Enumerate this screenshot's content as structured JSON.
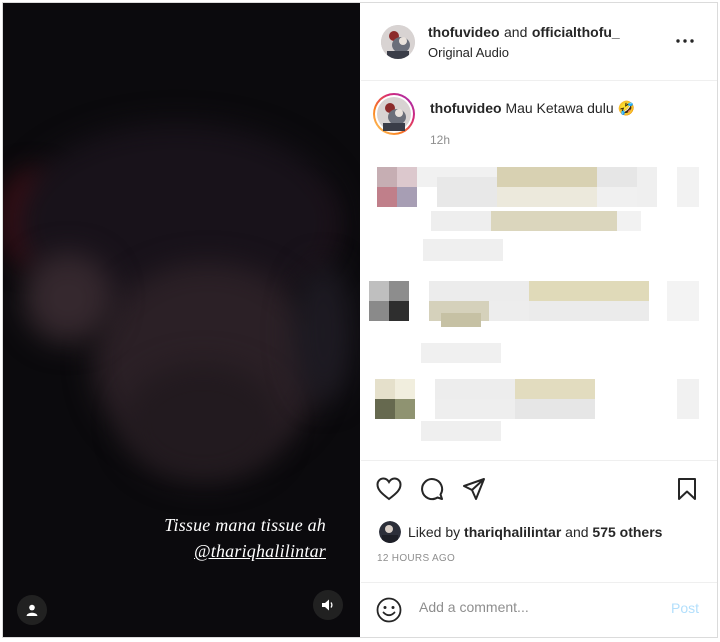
{
  "video": {
    "caption_line1": "Tissue mana tissue ah",
    "caption_line2": "@thariqhalilintar",
    "user_icon": "person-icon",
    "sound_icon": "speaker-icon"
  },
  "header": {
    "account1": "thofuvideo",
    "joiner": "and",
    "account2": "officialthofu_",
    "audio": "Original Audio",
    "more_icon": "more-options-icon"
  },
  "post": {
    "username": "thofuvideo",
    "caption": "Mau Ketawa dulu",
    "emoji": "🤣",
    "age": "12h"
  },
  "actions": {
    "liked_by_prefix": "Liked by",
    "liked_user": "thariqhalilintar",
    "and_text": "and",
    "others": "575 others",
    "timestamp": "12 HOURS AGO"
  },
  "composer": {
    "placeholder": "Add a comment...",
    "post_label": "Post"
  },
  "colors": {
    "link_blue_disabled": "#b2dffc",
    "text": "#262626",
    "muted": "#8e8e8e"
  }
}
